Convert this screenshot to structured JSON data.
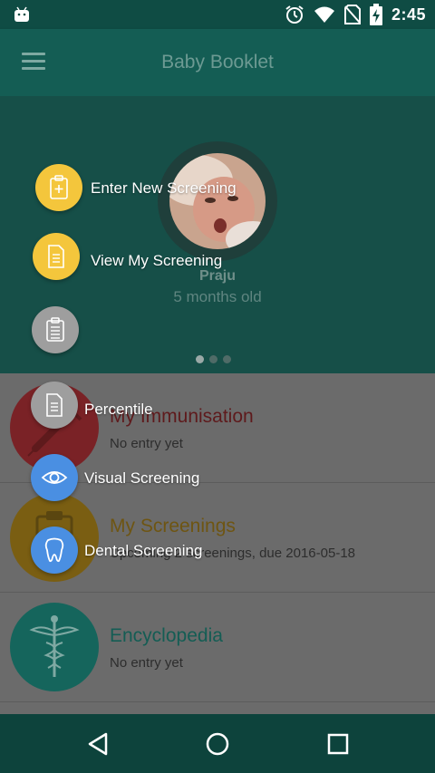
{
  "status_bar": {
    "time": "2:45",
    "left_icon": "android-icon",
    "icons": [
      "alarm-icon",
      "wifi-icon",
      "no-sim-icon",
      "battery-charging-icon"
    ]
  },
  "app_bar": {
    "title": "Baby Booklet",
    "menu_icon": "hamburger-menu-icon"
  },
  "profile": {
    "name": "Praju",
    "age": "5 months old",
    "page_dots": 3,
    "active_dot": 0
  },
  "list": {
    "items": [
      {
        "title": "My Immunisation",
        "subtitle": "No entry yet",
        "icon": "syringe-icon",
        "color": "#7a2226",
        "title_color": "#5e1a1c"
      },
      {
        "title": "My Screenings",
        "subtitle": "Upcoming 2 screenings, due 2016-05-18",
        "icon": "clipboard-icon",
        "color": "#7a5e12",
        "title_color": "#6e5512"
      },
      {
        "title": "Encyclopedia",
        "subtitle": "No entry yet",
        "icon": "caduceus-icon",
        "color": "#15655c",
        "title_color": "#145d54"
      }
    ]
  },
  "fab_menu": {
    "items": [
      {
        "label": "Enter New Screening",
        "icon": "add-clipboard-icon",
        "color": "#f4c63c"
      },
      {
        "label": "View My Screening",
        "icon": "document-icon",
        "color": "#f4c63c"
      },
      {
        "label": "",
        "icon": "clipboard-list-icon",
        "color": "#9e9e9e"
      },
      {
        "label": "Percentile",
        "icon": "document-icon",
        "color": "#9e9e9e"
      },
      {
        "label": "Visual Screening",
        "icon": "eye-icon",
        "color": "#4a8fe2"
      },
      {
        "label": "Dental Screening",
        "icon": "tooth-icon",
        "color": "#4a8fe2"
      }
    ]
  },
  "nav_bar": {
    "buttons": [
      "back-icon",
      "home-icon",
      "recents-icon"
    ]
  }
}
